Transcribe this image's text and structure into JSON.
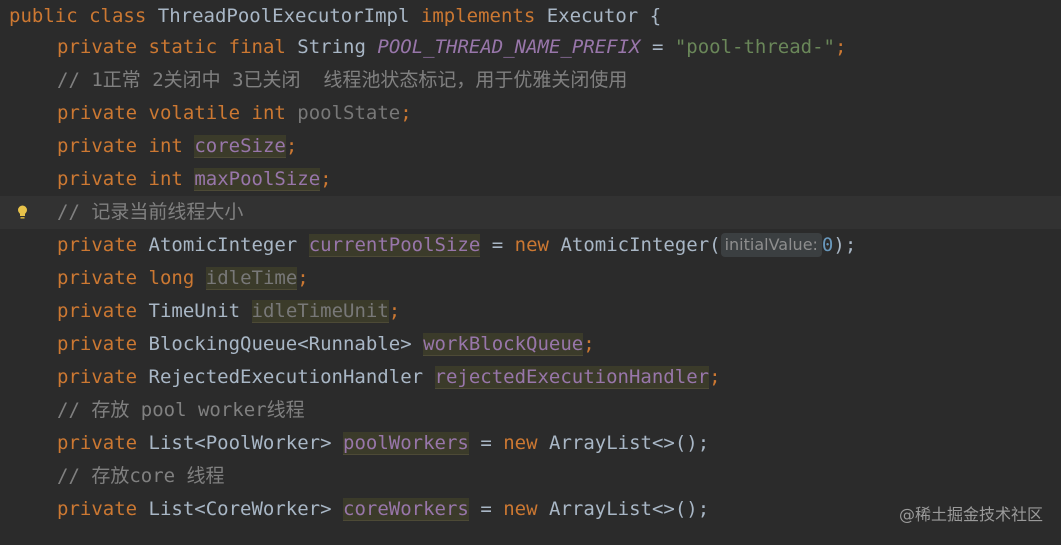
{
  "code": {
    "line1": {
      "kw1": "public",
      "kw2": "class",
      "cls": "ThreadPoolExecutorImpl",
      "kw3": "implements",
      "iface": "Executor",
      "brace": "{"
    },
    "line2": {
      "kw1": "private",
      "kw2": "static",
      "kw3": "final",
      "type": "String",
      "const": "POOL_THREAD_NAME_PREFIX",
      "eq": "=",
      "str": "\"pool-thread-\"",
      "semi": ";"
    },
    "line3": {
      "comment": "// 1正常 2关闭中 3已关闭  线程池状态标记，用于优雅关闭使用"
    },
    "line4": {
      "kw1": "private",
      "kw2": "volatile",
      "kw3": "int",
      "field": "poolState",
      "semi": ";"
    },
    "line5": {
      "kw1": "private",
      "kw2": "int",
      "field": "coreSize",
      "semi": ";"
    },
    "line6": {
      "kw1": "private",
      "kw2": "int",
      "field": "maxPoolSize",
      "semi": ";"
    },
    "line7": {
      "comment": "// 记录当前线程大小"
    },
    "line8": {
      "kw1": "private",
      "type": "AtomicInteger",
      "field": "currentPoolSize",
      "eq": "=",
      "kw2": "new",
      "ctor": "AtomicInteger(",
      "hint": "initialValue:",
      "num": "0",
      "end": ");"
    },
    "line9": {
      "kw1": "private",
      "kw2": "long",
      "field": "idleTime",
      "semi": ";"
    },
    "line10": {
      "kw1": "private",
      "type": "TimeUnit",
      "field": "idleTimeUnit",
      "semi": ";"
    },
    "line11": {
      "kw1": "private",
      "type": "BlockingQueue<Runnable>",
      "field": "workBlockQueue",
      "semi": ";"
    },
    "line12": {
      "kw1": "private",
      "type": "RejectedExecutionHandler",
      "field": "rejectedExecutionHandler",
      "semi": ";"
    },
    "line13": {
      "comment": "// 存放 pool worker线程"
    },
    "line14": {
      "kw1": "private",
      "type": "List<PoolWorker>",
      "field": "poolWorkers",
      "eq": "=",
      "kw2": "new",
      "ctor": "ArrayList<>();"
    },
    "line15": {
      "comment": "// 存放core 线程"
    },
    "line16": {
      "kw1": "private",
      "type": "List<CoreWorker>",
      "field": "coreWorkers",
      "eq": "=",
      "kw2": "new",
      "ctor": "ArrayList<>();"
    }
  },
  "gutter": {
    "icon": "lightbulb-icon",
    "color": "#e8c34a"
  },
  "watermark": "@稀土掘金技术社区",
  "colors": {
    "background": "#2b2b2b",
    "keyword": "#cc7832",
    "field": "#9876aa",
    "string": "#6a8759",
    "comment": "#808080",
    "number": "#6897bb",
    "text": "#a9b7c6"
  }
}
